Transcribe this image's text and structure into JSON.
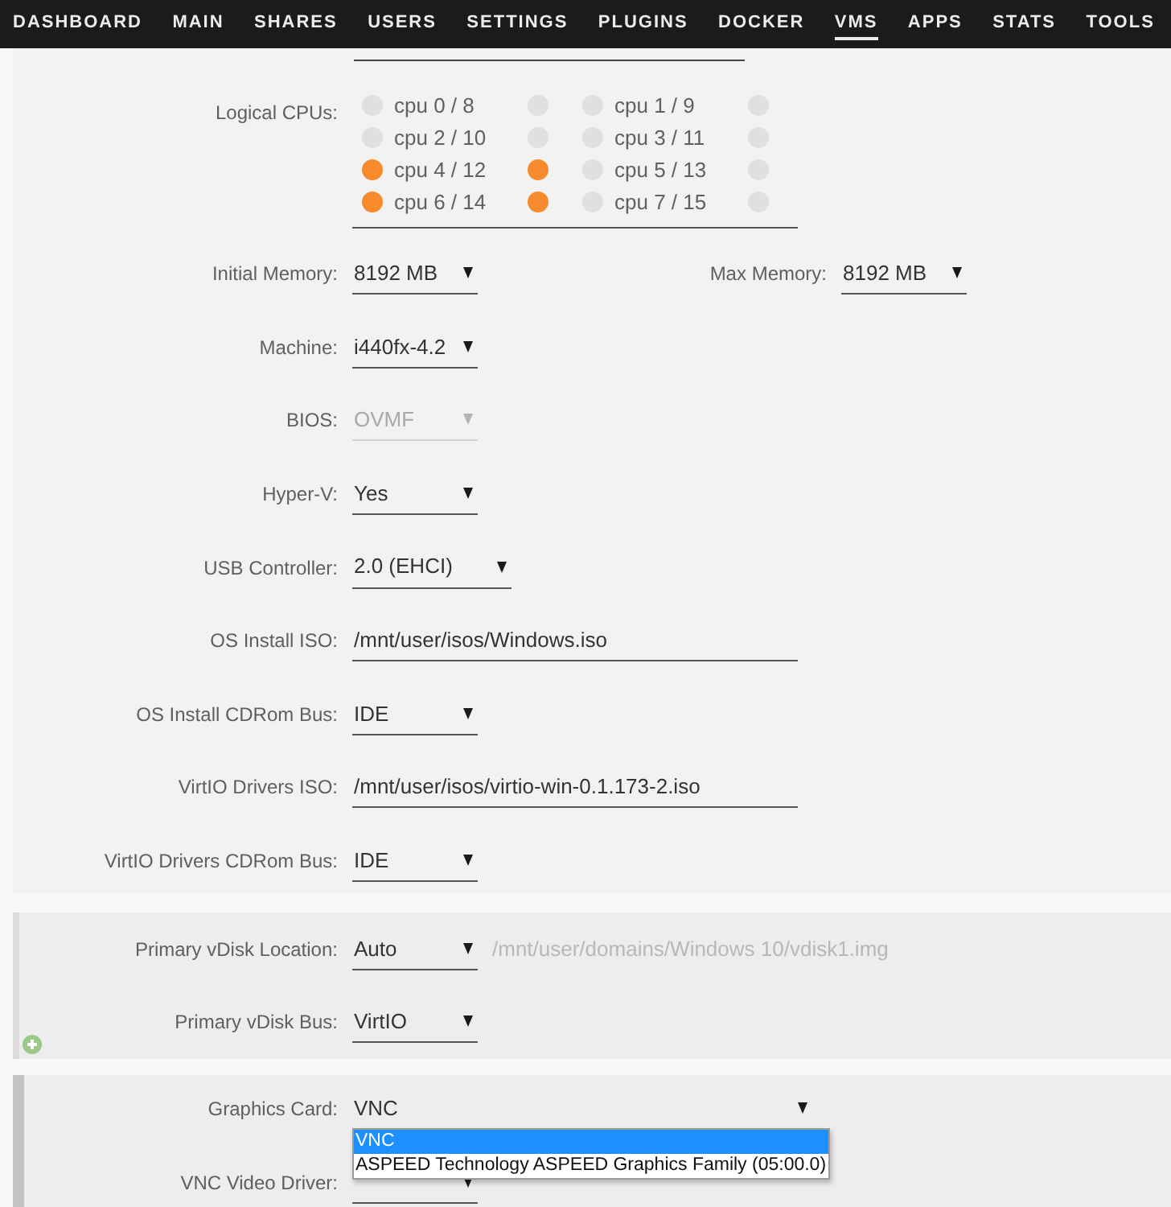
{
  "nav": {
    "items": [
      {
        "label": "DASHBOARD",
        "selected": false
      },
      {
        "label": "MAIN",
        "selected": false
      },
      {
        "label": "SHARES",
        "selected": false
      },
      {
        "label": "USERS",
        "selected": false
      },
      {
        "label": "SETTINGS",
        "selected": false
      },
      {
        "label": "PLUGINS",
        "selected": false
      },
      {
        "label": "DOCKER",
        "selected": false
      },
      {
        "label": "VMS",
        "selected": true
      },
      {
        "label": "APPS",
        "selected": false
      },
      {
        "label": "STATS",
        "selected": false
      },
      {
        "label": "TOOLS",
        "selected": false
      }
    ]
  },
  "sections": [
    {
      "kind": "plain",
      "rows": [
        {
          "kind": "clipped_field"
        },
        {
          "kind": "cpus",
          "label": "Logical CPUs:",
          "cpus": [
            {
              "label": "cpu 0 / 8",
              "threads": [
                {
                  "checked": false
                },
                {
                  "checked": false
                }
              ]
            },
            {
              "label": "cpu 1 / 9",
              "threads": [
                {
                  "checked": false
                },
                {
                  "checked": false
                }
              ]
            },
            {
              "label": "cpu 2 / 10",
              "threads": [
                {
                  "checked": false
                },
                {
                  "checked": false
                }
              ]
            },
            {
              "label": "cpu 3 / 11",
              "threads": [
                {
                  "checked": false
                },
                {
                  "checked": false
                }
              ]
            },
            {
              "label": "cpu 4 / 12",
              "threads": [
                {
                  "checked": true
                },
                {
                  "checked": true
                }
              ]
            },
            {
              "label": "cpu 5 / 13",
              "threads": [
                {
                  "checked": false
                },
                {
                  "checked": false
                }
              ]
            },
            {
              "label": "cpu 6 / 14",
              "threads": [
                {
                  "checked": true
                },
                {
                  "checked": true
                }
              ]
            },
            {
              "label": "cpu 7 / 15",
              "threads": [
                {
                  "checked": false
                },
                {
                  "checked": false
                }
              ]
            }
          ]
        },
        {
          "kind": "select_pair",
          "fields": [
            {
              "label": "Initial Memory:",
              "value": "8192 MB",
              "disabled": false
            },
            {
              "label": "Max Memory:",
              "value": "8192 MB",
              "disabled": false
            }
          ]
        },
        {
          "kind": "select",
          "label": "Machine:",
          "value": "i440fx-4.2",
          "disabled": false
        },
        {
          "kind": "select",
          "label": "BIOS:",
          "value": "OVMF",
          "disabled": true
        },
        {
          "kind": "select",
          "label": "Hyper-V:",
          "value": "Yes",
          "disabled": false
        },
        {
          "kind": "select_wide",
          "label": "USB Controller:",
          "value": "2.0 (EHCI)",
          "disabled": false
        },
        {
          "kind": "path",
          "label": "OS Install ISO:",
          "value": "/mnt/user/isos/Windows.iso",
          "disabled": false
        },
        {
          "kind": "select",
          "label": "OS Install CDRom Bus:",
          "value": "IDE",
          "disabled": false
        },
        {
          "kind": "path",
          "label": "VirtIO Drivers ISO:",
          "value": "/mnt/user/isos/virtio-win-0.1.173-2.iso",
          "disabled": false
        },
        {
          "kind": "select",
          "label": "VirtIO Drivers CDRom Bus:",
          "value": "IDE",
          "disabled": false
        }
      ]
    },
    {
      "kind": "panel",
      "highlighted": false,
      "add_button": true,
      "rows": [
        {
          "kind": "select",
          "label": "Primary vDisk Location:",
          "value": "Auto",
          "disabled": false,
          "note": "/mnt/user/domains/Windows 10/vdisk1.img"
        },
        {
          "kind": "select",
          "label": "Primary vDisk Bus:",
          "value": "VirtIO",
          "disabled": false
        }
      ]
    },
    {
      "kind": "panel",
      "highlighted": true,
      "rows": [
        {
          "kind": "select_long",
          "label": "Graphics Card:",
          "value": "VNC",
          "disabled": false,
          "expanded": true,
          "options": [
            {
              "label": "VNC",
              "selected": true
            },
            {
              "label": "ASPEED Technology ASPEED Graphics Family (05:00.0)",
              "selected": false
            }
          ]
        },
        {
          "kind": "select",
          "label": "VNC Video Driver:",
          "disabled": false
        }
      ]
    }
  ]
}
